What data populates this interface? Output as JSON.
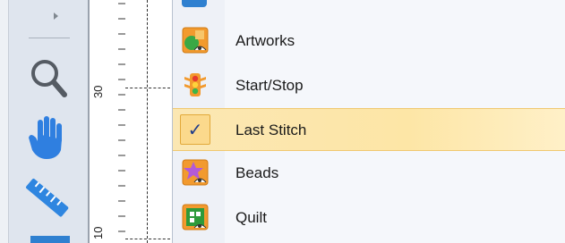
{
  "ruler": {
    "labels": [
      "30",
      "10"
    ]
  },
  "toolstrip": {
    "tools": [
      {
        "name": "zoom-tool",
        "icon": "magnifier-icon"
      },
      {
        "name": "pan-tool",
        "icon": "hand-icon"
      },
      {
        "name": "measure-tool",
        "icon": "ruler-icon"
      }
    ]
  },
  "menu": {
    "items": [
      {
        "label": "Artworks",
        "icon": "artworks-icon",
        "checked": false,
        "highlighted": false
      },
      {
        "label": "Start/Stop",
        "icon": "traffic-light-icon",
        "checked": false,
        "highlighted": false
      },
      {
        "label": "Last Stitch",
        "icon": "checkmark-icon",
        "check_glyph": "✓",
        "checked": true,
        "highlighted": true
      },
      {
        "label": "Beads",
        "icon": "beads-icon",
        "checked": false,
        "highlighted": false
      },
      {
        "label": "Quilt",
        "icon": "quilt-icon",
        "checked": false,
        "highlighted": false
      }
    ]
  },
  "colors": {
    "highlight": "#fde6a6",
    "highlight_border": "#f0c870",
    "accent_blue": "#2f80d0",
    "icon_orange": "#f29a2e"
  }
}
